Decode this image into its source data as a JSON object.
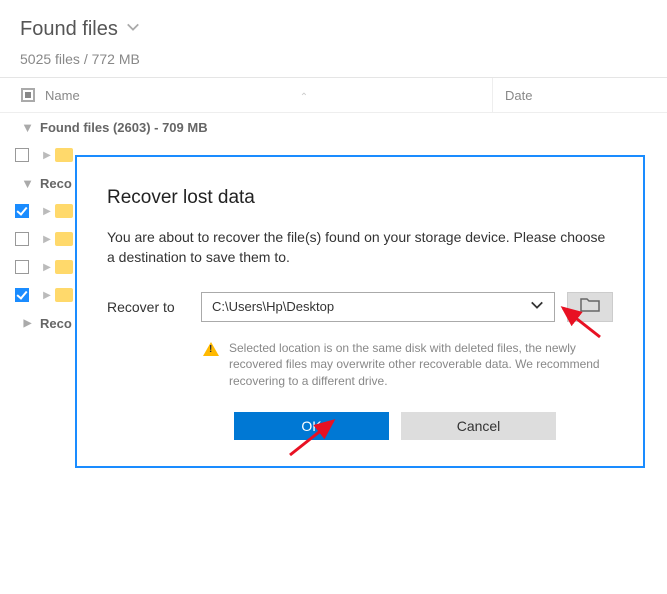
{
  "header": {
    "title": "Found files",
    "subtitle": "5025 files / 772 MB"
  },
  "columns": {
    "name": "Name",
    "date": "Date"
  },
  "groups": {
    "found": "Found files (2603) - 709 MB",
    "reconstructed_prefix": "Reco"
  },
  "modal": {
    "title": "Recover lost data",
    "body": "You are about to recover the file(s) found on your storage device. Please choose a destination to save them to.",
    "field_label": "Recover to",
    "path": "C:\\Users\\Hp\\Desktop",
    "warning": "Selected location is on the same disk with deleted files, the newly recovered files may overwrite other recoverable data. We recommend recovering to a different drive.",
    "ok": "OK",
    "cancel": "Cancel"
  }
}
